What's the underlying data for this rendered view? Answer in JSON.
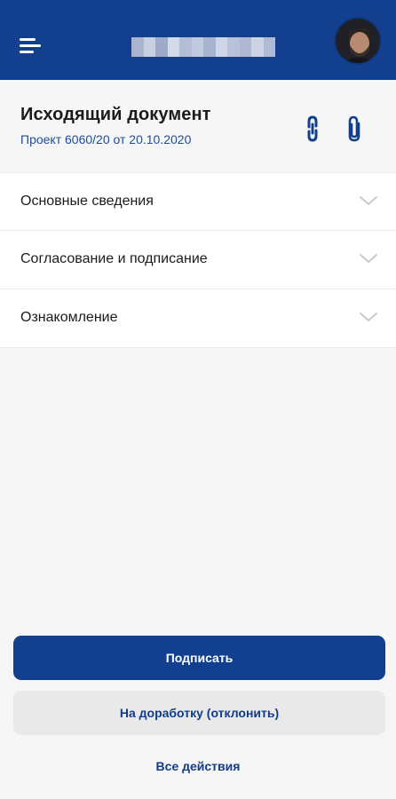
{
  "header": {
    "user_name_redacted": "",
    "colors": {
      "bar": "#12408f",
      "accent": "#1d4c9e"
    }
  },
  "document": {
    "title": "Исходящий документ",
    "subtitle": "Проект 6060/20 от 20.10.2020"
  },
  "sections": [
    {
      "label": "Основные сведения"
    },
    {
      "label": "Согласование и подписание"
    },
    {
      "label": "Ознакомление"
    }
  ],
  "actions": {
    "sign_label": "Подписать",
    "reject_label": "На доработку (отклонить)",
    "all_actions_label": "Все действия"
  },
  "icons": {
    "menu": "menu-icon",
    "link": "link-icon",
    "attachment": "paperclip-icon",
    "chevron": "chevron-down-icon"
  }
}
